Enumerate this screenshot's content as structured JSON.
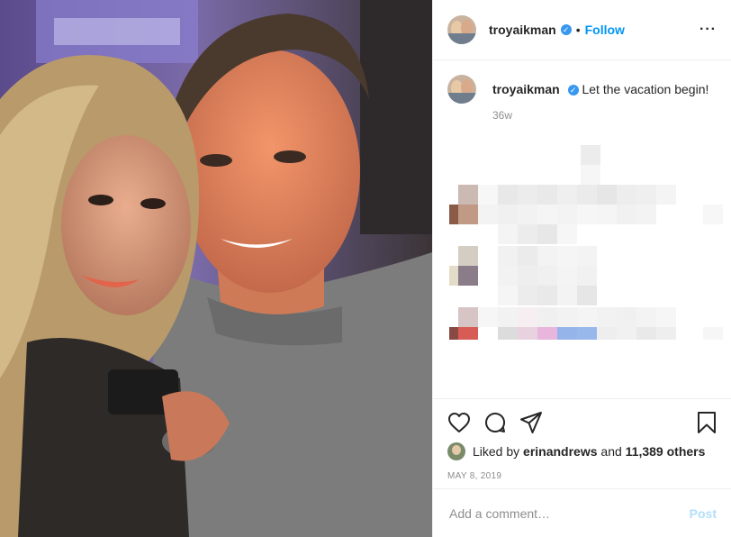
{
  "post": {
    "photo_alt": "",
    "author": {
      "username": "troyaikman",
      "verified": true
    },
    "header": {
      "separator": "•",
      "follow_label": "Follow",
      "more_label": "···"
    },
    "caption": {
      "username": "troyaikman",
      "text": "Let the vacation begin!",
      "age": "36w"
    },
    "actions": {
      "icons": [
        "heart-icon",
        "comment-icon",
        "share-icon",
        "bookmark-icon"
      ]
    },
    "likes": {
      "prefix": "Liked by",
      "user": "erinandrews",
      "conjunction": "and",
      "others": "11,389 others"
    },
    "date": "MAY 8, 2019",
    "add_comment": {
      "placeholder": "Add a comment…",
      "post_label": "Post"
    }
  },
  "colors": {
    "link": "#0095f6",
    "verified": "#3897f0",
    "muted": "#8e8e8e",
    "post_disabled": "#b2dffc",
    "border": "#efefef"
  }
}
